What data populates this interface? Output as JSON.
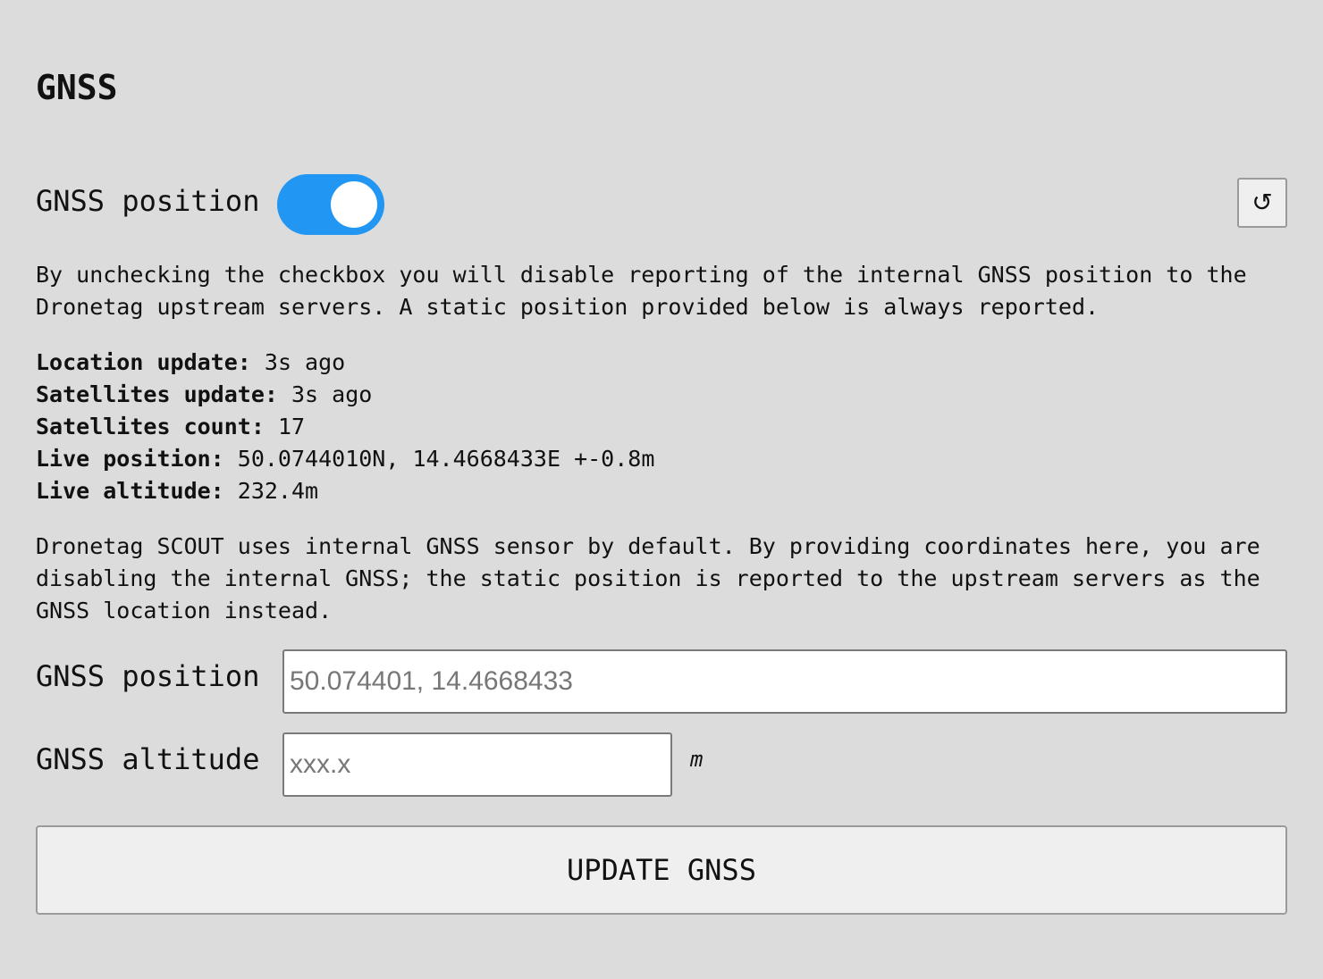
{
  "page": {
    "title": "GNSS"
  },
  "toggle": {
    "label": "GNSS position",
    "state": true,
    "accent_color": "#2196f3"
  },
  "reset_button": {
    "glyph": "↺",
    "icon": "reset-icon"
  },
  "description": "By unchecking the checkbox you will disable reporting of the internal GNSS position to the Dronetag upstream servers. A static position provided below is always reported.",
  "stats": [
    {
      "key": "Location update:",
      "value": "3s ago"
    },
    {
      "key": "Satellites update:",
      "value": "3s ago"
    },
    {
      "key": "Satellites count:",
      "value": "17"
    },
    {
      "key": "Live position:",
      "value": "50.0744010N, 14.4668433E +-0.8m"
    },
    {
      "key": "Live altitude:",
      "value": "232.4m"
    }
  ],
  "info": "Dronetag SCOUT uses internal GNSS sensor by default. By providing coordinates here, you are disabling the internal GNSS; the static position is reported to the upstream servers as the GNSS location instead.",
  "fields": {
    "position": {
      "label": "GNSS position",
      "value": "",
      "placeholder": "50.074401, 14.4668433"
    },
    "altitude": {
      "label": "GNSS altitude",
      "value": "",
      "placeholder": "xxx.x",
      "unit": "m"
    }
  },
  "submit": {
    "label": "UPDATE GNSS"
  }
}
